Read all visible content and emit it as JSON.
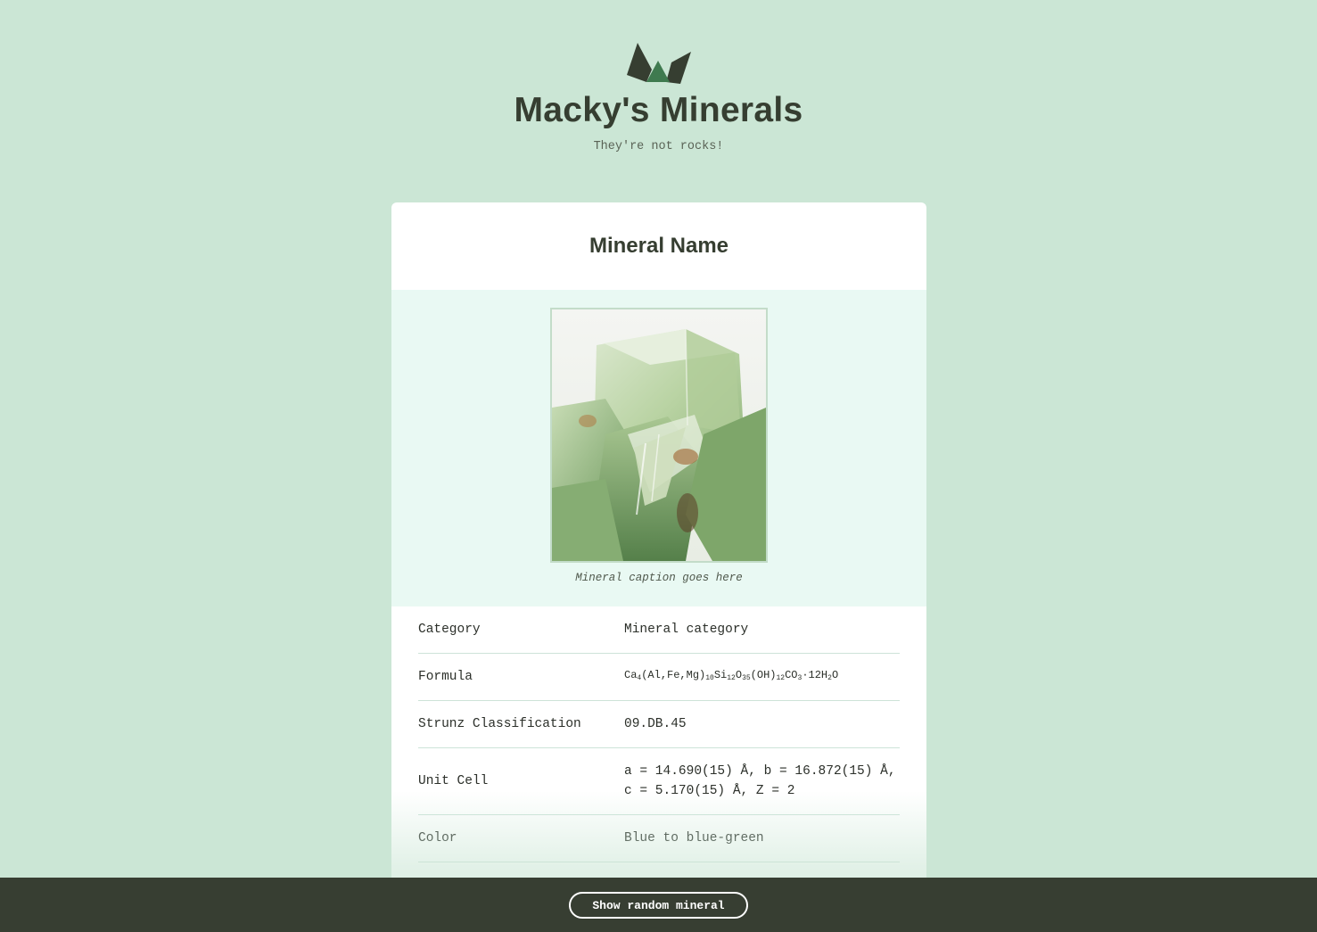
{
  "header": {
    "logo_icon": "mountain-crystals-logo",
    "title": "Macky's Minerals",
    "tagline": "They're not rocks!"
  },
  "card": {
    "title": "Mineral Name",
    "image_icon": "mineral-photo",
    "caption": "Mineral caption goes here",
    "properties": [
      {
        "label": "Category",
        "value": "Mineral category"
      },
      {
        "label": "Formula",
        "value": "Ca4(Al,Fe,Mg)10Si12O35(OH)12CO3·12H2O"
      },
      {
        "label": "Strunz Classification",
        "value": "09.DB.45"
      },
      {
        "label": "Unit Cell",
        "value": "a = 14.690(15) Å, b = 16.872(15) Å, c = 5.170(15) Å, Z = 2"
      },
      {
        "label": "Color",
        "value": "Blue to blue-green"
      }
    ]
  },
  "footer": {
    "random_button_label": "Show random mineral"
  },
  "colors": {
    "background": "#cbe6d5",
    "image_section": "#e9f9f3",
    "footer": "#373e32",
    "heading": "#363e31",
    "logo_dark": "#363e31",
    "logo_accent": "#3f7a4f"
  }
}
